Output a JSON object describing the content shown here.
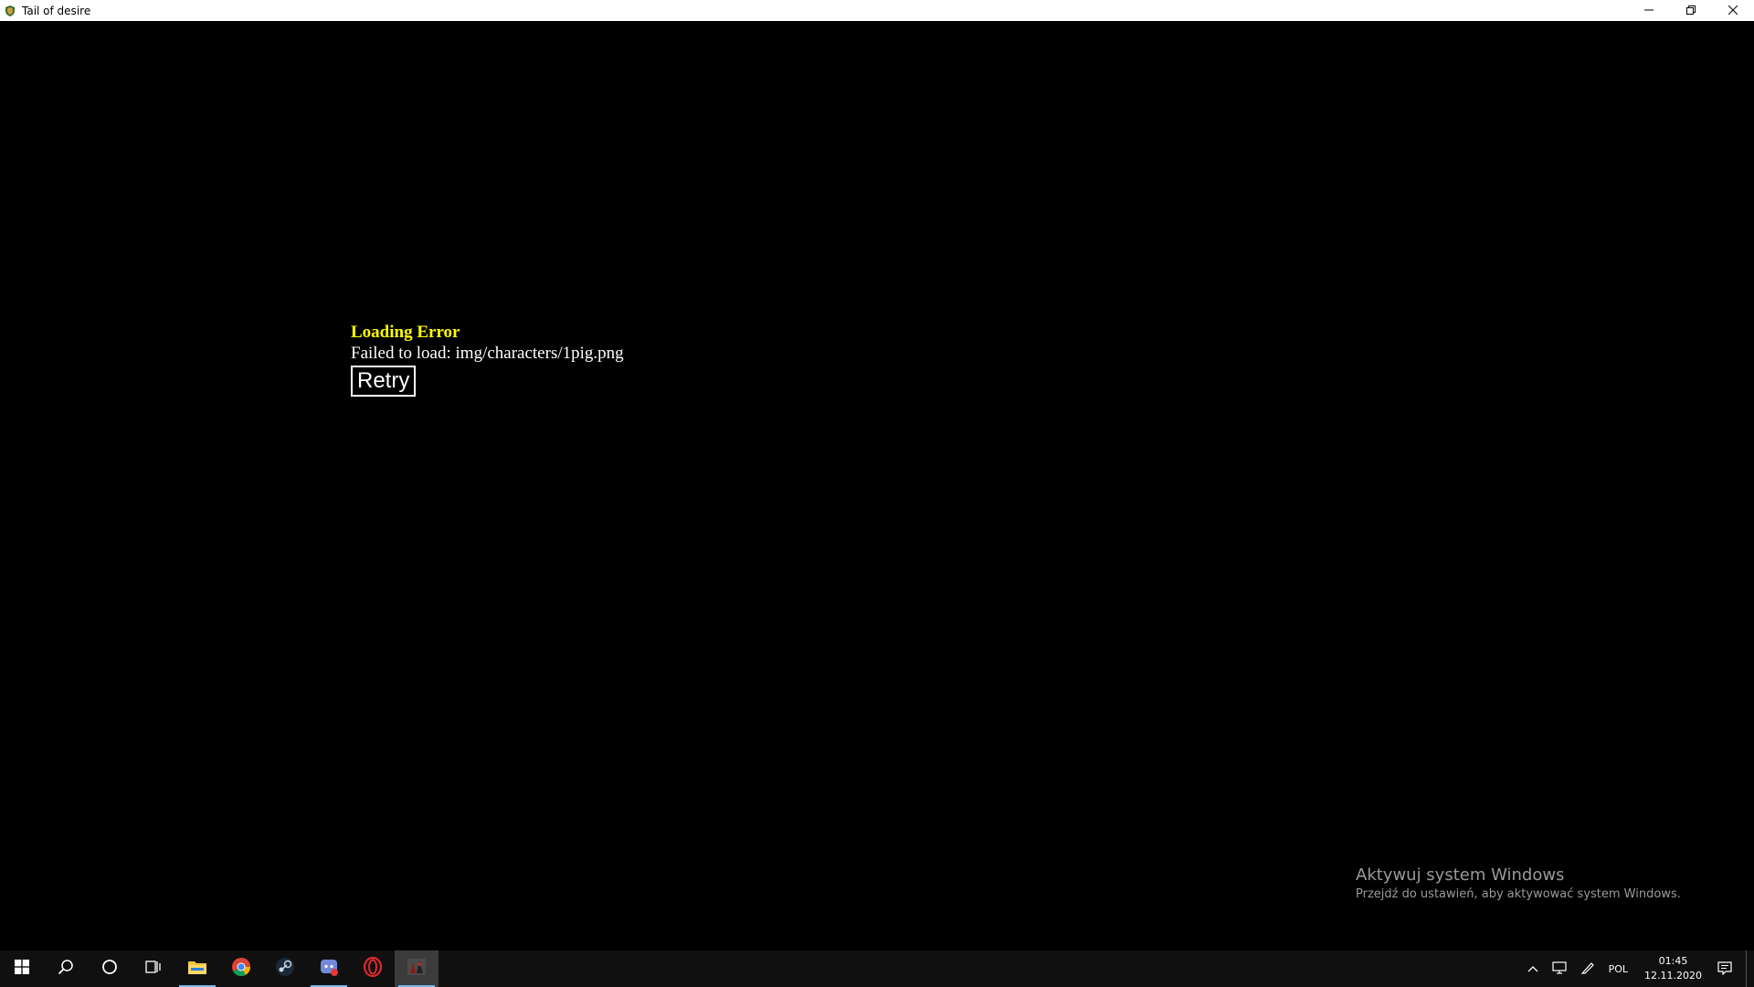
{
  "window": {
    "title": "Tail of desire",
    "icons": {
      "app": "shield-icon",
      "minimize": "minimize-icon",
      "restore": "restore-icon",
      "close": "close-icon"
    }
  },
  "error": {
    "title": "Loading Error",
    "message": "Failed to load: img/characters/1pig.png",
    "retry_label": "Retry",
    "title_color": "#ffff00"
  },
  "watermark": {
    "line1": "Aktywuj system Windows",
    "line2": "Przejdź do ustawień, aby aktywować system Windows."
  },
  "taskbar": {
    "items": [
      {
        "name": "start-button",
        "icon": "windows-logo-icon"
      },
      {
        "name": "search-button",
        "icon": "search-icon"
      },
      {
        "name": "cortana-button",
        "icon": "circle-icon"
      },
      {
        "name": "task-view-button",
        "icon": "task-view-icon"
      },
      {
        "name": "file-explorer-button",
        "icon": "folder-icon"
      },
      {
        "name": "chrome-button",
        "icon": "chrome-icon"
      },
      {
        "name": "steam-button",
        "icon": "steam-icon"
      },
      {
        "name": "discord-button",
        "icon": "discord-icon"
      },
      {
        "name": "opera-button",
        "icon": "opera-icon"
      },
      {
        "name": "game-button",
        "icon": "game-app-icon"
      }
    ],
    "tray": {
      "language": "POL",
      "time": "01:45",
      "date": "12.11.2020"
    }
  }
}
